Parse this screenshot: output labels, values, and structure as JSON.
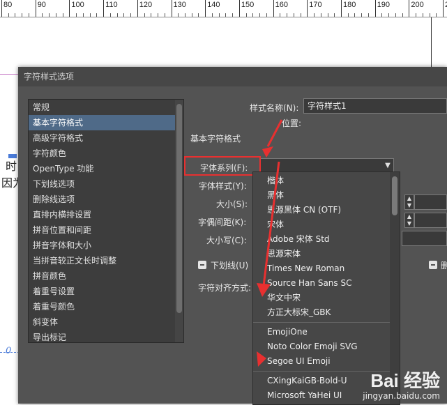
{
  "ruler": {
    "labels": [
      "80",
      "90",
      "100",
      "110",
      "120",
      "130",
      "140",
      "150",
      "160",
      "170",
      "180",
      "190",
      "200",
      "210"
    ]
  },
  "document": {
    "text_line1": "时",
    "text_line2": "因为",
    "mark_glyph": "0"
  },
  "dialog": {
    "title": "字符样式选项",
    "categories": [
      "常规",
      "基本字符格式",
      "高级字符格式",
      "字符颜色",
      "OpenType 功能",
      "下划线选项",
      "删除线选项",
      "直排内横排设置",
      "拼音位置和间距",
      "拼音字体和大小",
      "当拼音较正文长时调整",
      "拼音颜色",
      "着重号设置",
      "着重号颜色",
      "斜变体",
      "导出标记"
    ],
    "selected_category": "基本字符格式",
    "style_name_label": "样式名称(N):",
    "style_name_value": "字符样式1",
    "location_label": "位置:",
    "section_title": "基本字符格式",
    "font_family_label": "字体系列(F):",
    "font_style_label": "字体样式(Y):",
    "size_label": "大小(S):",
    "kerning_label": "字偶间距(K):",
    "case_label": "大小写(C):",
    "underline_label": "下划线(U)",
    "align_label": "字符对齐方式:",
    "right_checkbox_label": "删"
  },
  "font_dropdown": {
    "group1": [
      "楷体",
      "黑体",
      "思源黑体 CN (OTF)",
      "宋体",
      "Adobe 宋体 Std",
      "思源宋体",
      "Times New Roman",
      "Source Han Sans SC",
      "华文中宋",
      "方正大标宋_GBK"
    ],
    "group2": [
      "EmojiOne",
      "Noto Color Emoji SVG",
      "Segoe UI Emoji"
    ],
    "group3": [
      "CXingKaiGB-Bold-U",
      "Microsoft YaHei UI"
    ]
  },
  "watermark": {
    "logo_text": "Bai 经验",
    "url": "jingyan.baidu.com"
  },
  "colors": {
    "accent_red": "#e83030",
    "selection": "#4f6a88",
    "dialog_bg": "#535353"
  }
}
